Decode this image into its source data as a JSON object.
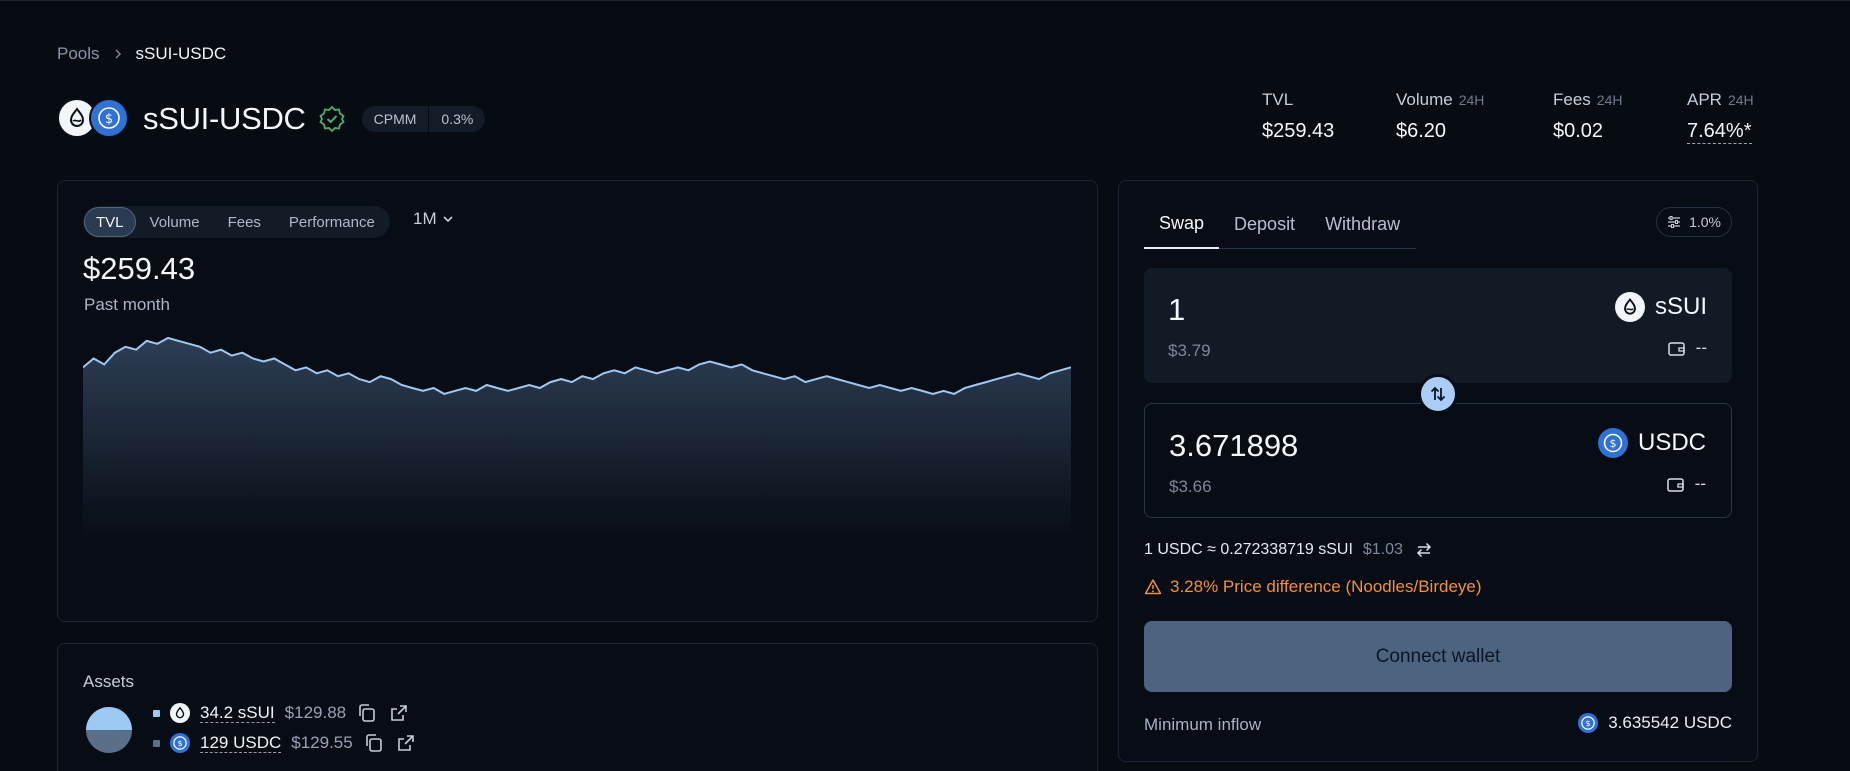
{
  "breadcrumb": {
    "parent": "Pools",
    "current": "sSUI-USDC"
  },
  "pool": {
    "title": "sSUI-USDC",
    "type_tag": "CPMM",
    "fee_tag": "0.3%",
    "icons": [
      "sui-drop-icon",
      "usdc-icon"
    ]
  },
  "stats": {
    "tvl": {
      "label": "TVL",
      "period": "",
      "value": "$259.43"
    },
    "volume": {
      "label": "Volume",
      "period": "24H",
      "value": "$6.20"
    },
    "fees": {
      "label": "Fees",
      "period": "24H",
      "value": "$0.02"
    },
    "apr": {
      "label": "APR",
      "period": "24H",
      "value": "7.64%*"
    }
  },
  "chart_panel": {
    "tabs": [
      "TVL",
      "Volume",
      "Fees",
      "Performance"
    ],
    "active_tab": "TVL",
    "range": "1M",
    "headline": "$259.43",
    "subtitle": "Past month"
  },
  "chart_data": {
    "type": "area",
    "xlabel": "",
    "ylabel": "",
    "grid": false,
    "values": [
      259,
      262,
      260,
      264,
      266,
      265,
      268,
      267,
      269,
      268,
      267,
      266,
      264,
      265,
      263,
      264,
      262,
      261,
      262,
      260,
      258,
      259,
      257,
      258,
      256,
      257,
      255,
      254,
      256,
      255,
      253,
      252,
      251,
      252,
      250,
      251,
      252,
      251,
      253,
      252,
      251,
      252,
      253,
      252,
      254,
      255,
      254,
      256,
      255,
      257,
      258,
      257,
      259,
      258,
      257,
      258,
      259,
      258,
      260,
      261,
      260,
      259,
      260,
      258,
      257,
      256,
      255,
      256,
      254,
      255,
      256,
      255,
      254,
      253,
      252,
      253,
      252,
      251,
      252,
      251,
      250,
      251,
      250,
      252,
      253,
      254,
      255,
      256,
      257,
      256,
      255,
      257,
      258,
      259
    ]
  },
  "assets": {
    "title": "Assets",
    "items": [
      {
        "amount": "34.2 sSUI",
        "usd": "$129.88",
        "color": "#9ccaf5",
        "share": 0.5007
      },
      {
        "amount": "129 USDC",
        "usd": "$129.55",
        "color": "#5a6f88",
        "share": 0.4993
      }
    ]
  },
  "swap": {
    "tabs": [
      "Swap",
      "Deposit",
      "Withdraw"
    ],
    "active_tab": "Swap",
    "slippage": "1.0%",
    "from": {
      "amount": "1",
      "usd": "$3.79",
      "token": "sSUI",
      "balance": "--"
    },
    "to": {
      "amount": "3.671898",
      "usd": "$3.66",
      "token": "USDC",
      "balance": "--"
    },
    "rate": "1 USDC ≈ 0.272338719 sSUI",
    "rate_usd": "$1.03",
    "warning": "3.28% Price difference (Noodles/Birdeye)",
    "connect_label": "Connect wallet",
    "min_label": "Minimum inflow",
    "min_value": "3.635542 USDC"
  },
  "colors": {
    "background": "#070b12",
    "accent": "#a9cdf6",
    "warning": "#f0913c",
    "verified": "#4caf6a",
    "usdc": "#2f71d4"
  }
}
